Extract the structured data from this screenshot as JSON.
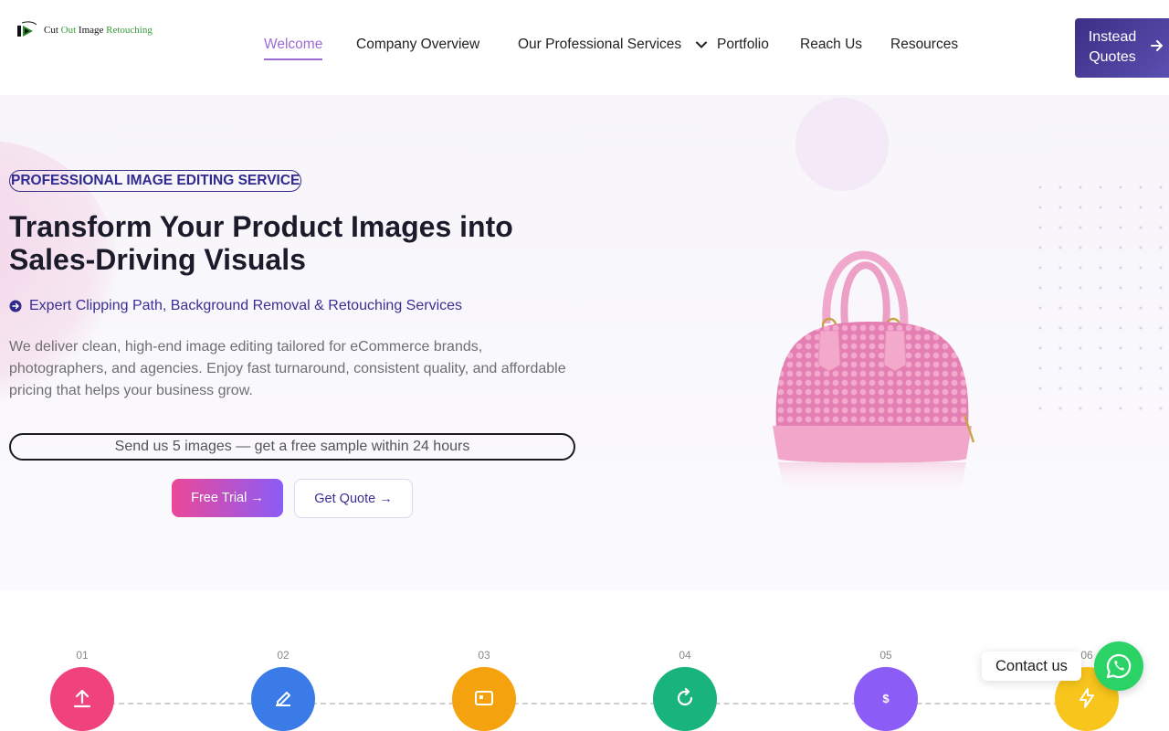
{
  "logo": {
    "w1": "Cut",
    "w2": "Out",
    "w3": "Image",
    "w4": "Retouching"
  },
  "nav": {
    "items": [
      {
        "label": "Welcome"
      },
      {
        "label": "Company Overview"
      },
      {
        "label": "Our Professional Services"
      },
      {
        "label": "Portfolio"
      },
      {
        "label": "Reach Us"
      },
      {
        "label": "Resources"
      }
    ]
  },
  "header_cta": {
    "label": "Instead Quotes"
  },
  "hero": {
    "badge": "PROFESSIONAL IMAGE EDITING SERVICE",
    "title": "Transform Your Product Images into Sales-Driving Visuals",
    "subtitle": "Expert Clipping Path, Background Removal & Retouching Services",
    "description": "We deliver clean, high-end image editing tailored for eCommerce brands, photographers, and agencies. Enjoy fast turnaround, consistent quality, and affordable pricing that helps your business grow.",
    "sample_offer": "Send us 5 images — get a free sample within 24 hours",
    "primary_btn": "Free Trial →",
    "secondary_btn": "Get Quote →"
  },
  "steps": [
    {
      "num": "01",
      "color": "#f0437e",
      "icon": "upload-icon"
    },
    {
      "num": "02",
      "color": "#3b7be8",
      "icon": "edit-icon"
    },
    {
      "num": "03",
      "color": "#f4a20d",
      "icon": "image-icon"
    },
    {
      "num": "04",
      "color": "#19b37c",
      "icon": "refresh-icon"
    },
    {
      "num": "05",
      "color": "#8b5cf6",
      "icon": "dollar-icon"
    },
    {
      "num": "06",
      "color": "#f7c51b",
      "icon": "bolt-icon"
    }
  ],
  "contact": {
    "label": "Contact us"
  },
  "colors": {
    "accent": "#9b6bd6",
    "brand_dark": "#3b2f86",
    "whatsapp": "#2bd366"
  }
}
